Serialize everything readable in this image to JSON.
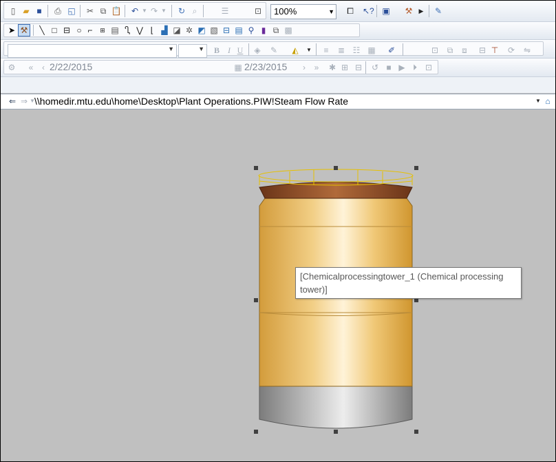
{
  "toolbar": {
    "zoom": "100%"
  },
  "time_bar": {
    "start_time": "2/22/2015",
    "end_time": "2/23/2015"
  },
  "address_bar": {
    "path": "\\\\homedir.mtu.edu\\home\\Desktop\\Plant Operations.PIW!Steam Flow Rate"
  },
  "canvas": {
    "tooltip": "[Chemicalprocessingtower_1 (Chemical processing tower)]",
    "background": "#c0c0c0"
  },
  "colors": {
    "tower_body": "#e9bd64",
    "tower_top": "#7a4424",
    "tower_base": "#a9a9a9",
    "selection_outline": "#e6c000"
  },
  "icons": [
    "new-icon",
    "open-icon",
    "save-icon",
    "print-icon",
    "print-preview-icon",
    "cut-icon",
    "copy-icon",
    "paste-icon",
    "undo-icon",
    "redo-icon",
    "find-icon",
    "zoom-fit-icon",
    "full-screen-icon",
    "help-icon",
    "pointer-icon",
    "edit-mode-icon",
    "line-icon",
    "rectangle-icon",
    "ellipse-icon",
    "arc-icon",
    "value-icon",
    "symbol-icon",
    "connector-icon",
    "trend-icon",
    "bar-icon",
    "refresh-icon",
    "back-icon",
    "forward-icon",
    "home-icon"
  ]
}
